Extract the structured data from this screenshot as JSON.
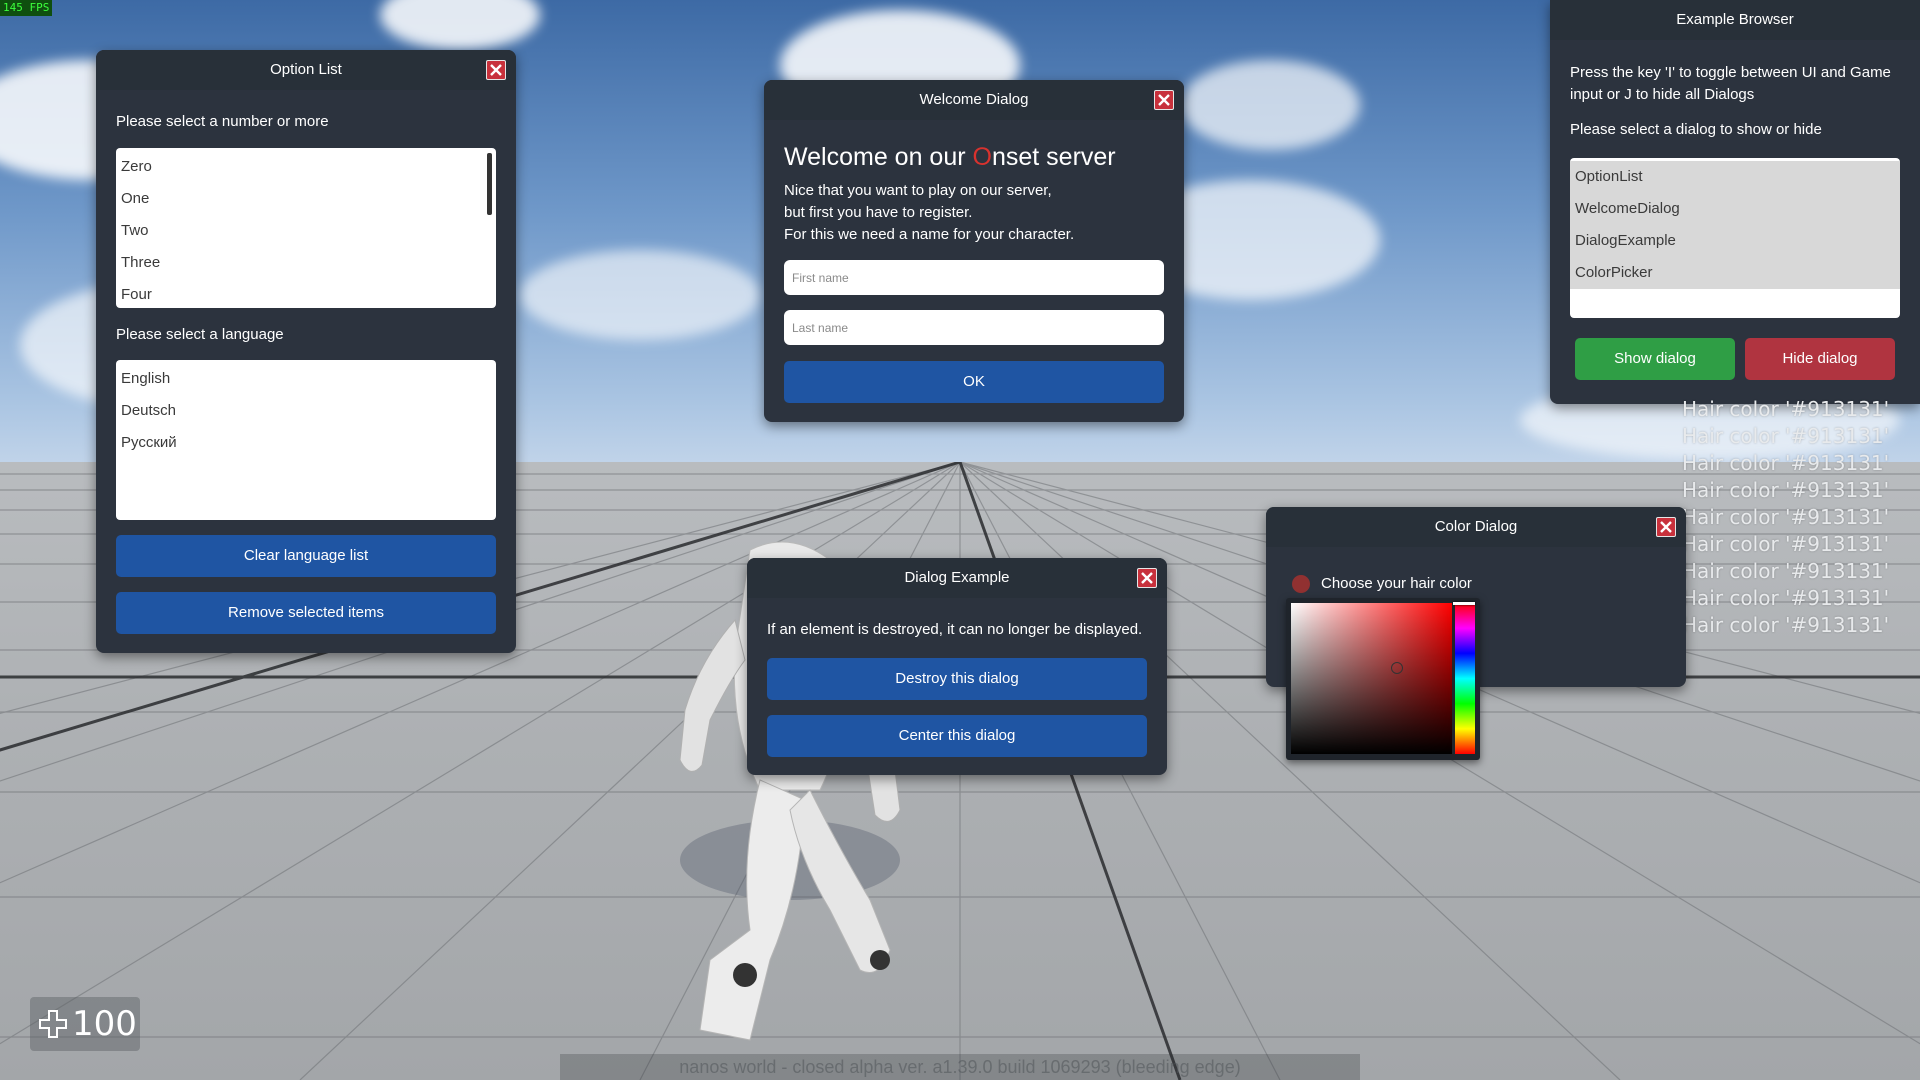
{
  "fps": "145 FPS",
  "health": "100",
  "footer": "nanos world - closed alpha  ver. a1.39.0  build 1069293  (bleeding edge)",
  "option_list": {
    "title": "Option List",
    "number_prompt": "Please select a number or more",
    "numbers": [
      "Zero",
      "One",
      "Two",
      "Three",
      "Four"
    ],
    "language_prompt": "Please select a language",
    "languages": [
      "English",
      "Deutsch",
      "Русский"
    ],
    "clear_button": "Clear language list",
    "remove_button": "Remove selected items"
  },
  "welcome": {
    "title": "Welcome Dialog",
    "heading_pre": "Welcome on our ",
    "heading_highlight": "O",
    "heading_post": "nset server",
    "line1": "Nice that you want to play on our server,",
    "line2": "but first you have to register.",
    "line3": "For this we need a name for your character.",
    "first_name_placeholder": "First name",
    "last_name_placeholder": "Last name",
    "ok_button": "OK"
  },
  "browser": {
    "title": "Example Browser",
    "instructions": "Press the key 'I' to toggle between UI and Game input or J to hide all Dialogs",
    "select_prompt": "Please select a dialog to show or hide",
    "items": [
      "OptionList",
      "WelcomeDialog",
      "DialogExample",
      "ColorPicker"
    ],
    "show_button": "Show dialog",
    "hide_button": "Hide dialog"
  },
  "dialog_example": {
    "title": "Dialog Example",
    "text": "If an element is destroyed, it can no longer be displayed.",
    "destroy_button": "Destroy this dialog",
    "center_button": "Center this dialog"
  },
  "color_dialog": {
    "title": "Color Dialog",
    "prompt": "Choose your hair color",
    "selected_color": "#913131"
  },
  "hair_log": [
    "Hair color '#913131'",
    "Hair color '#913131'",
    "Hair color '#913131'",
    "Hair color '#913131'",
    "Hair color '#913131'",
    "Hair color '#913131'",
    "Hair color '#913131'",
    "Hair color '#913131'",
    "Hair color '#913131'"
  ],
  "colors": {
    "panel": "#2c333e",
    "blue_button": "#1f55a3",
    "green_button": "#2f9e45",
    "red_button": "#b03440",
    "close": "#c8313c",
    "highlight_letter": "#d8322e"
  }
}
